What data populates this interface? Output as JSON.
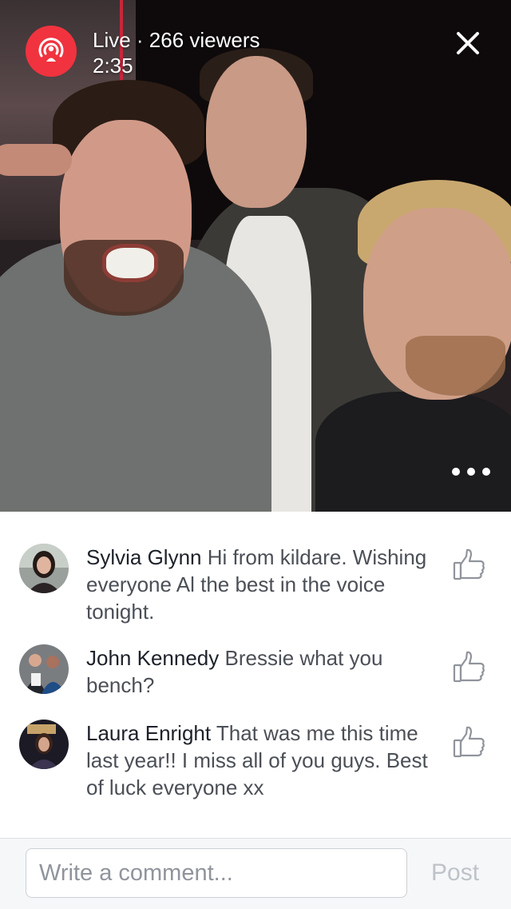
{
  "live": {
    "status": "Live · 266 viewers",
    "elapsed": "2:35",
    "badge_color": "#f0333f",
    "badge_icon": "live-broadcast-icon"
  },
  "controls": {
    "close_icon": "close-icon",
    "more_icon": "more-options-icon"
  },
  "comments": [
    {
      "name": "Sylvia Glynn",
      "text": "Hi from kildare. Wishing everyone  Al the best in the voice tonight."
    },
    {
      "name": "John Kennedy",
      "text": "Bressie what you bench?"
    },
    {
      "name": "Laura Enright",
      "text": "That was me this time last year!! I miss all of you guys. Best of luck everyone xx"
    }
  ],
  "composer": {
    "placeholder": "Write a comment...",
    "post_label": "Post"
  }
}
